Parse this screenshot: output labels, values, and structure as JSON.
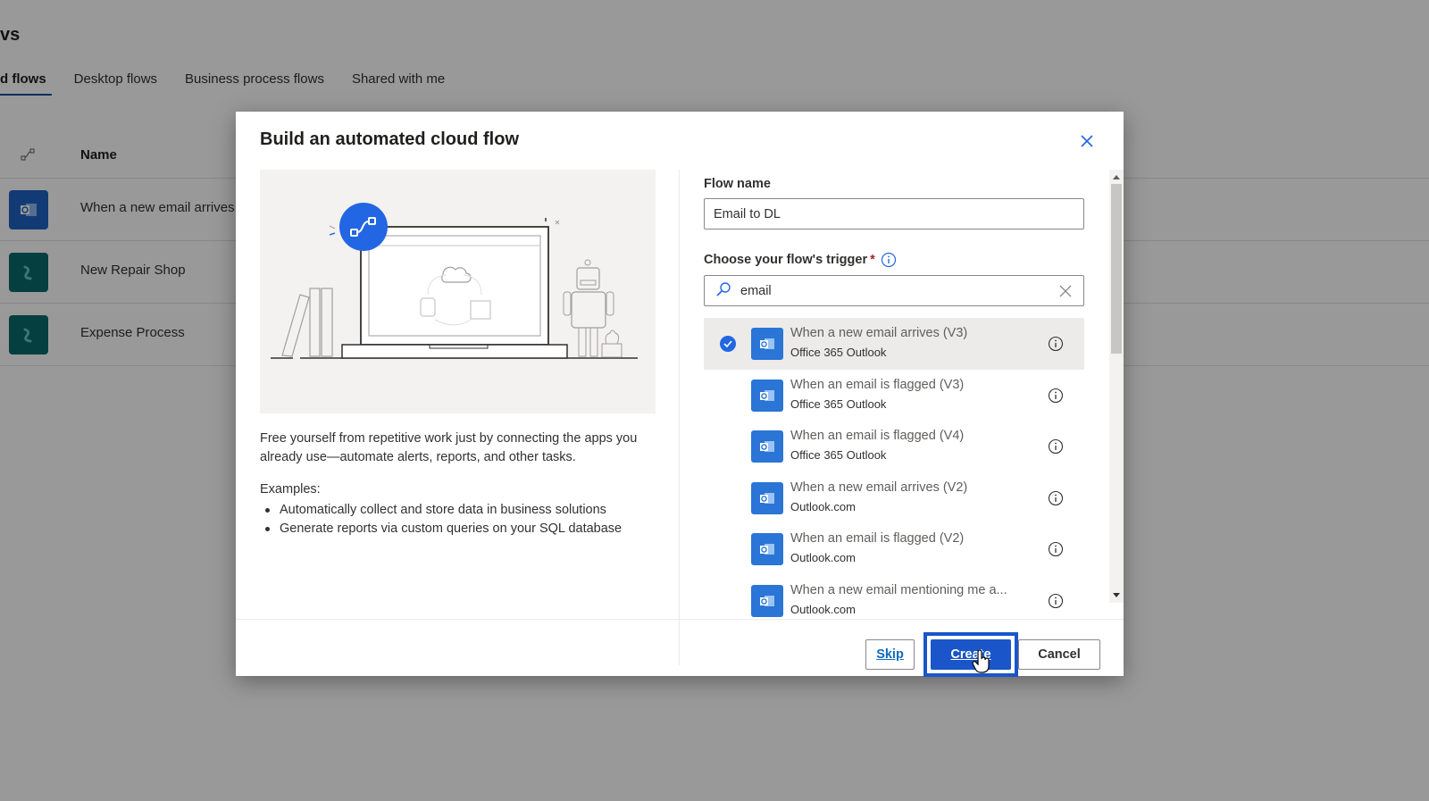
{
  "page": {
    "title": "vs",
    "tabs": [
      {
        "label": "d flows",
        "active": true
      },
      {
        "label": "Desktop flows",
        "active": false
      },
      {
        "label": "Business process flows",
        "active": false
      },
      {
        "label": "Shared with me",
        "active": false
      }
    ],
    "list": {
      "header": {
        "name": "Name",
        "type_icon": "flow-icon"
      },
      "rows": [
        {
          "name": "When a new email arrives",
          "icon": "outlook-icon",
          "color": "#1e63c4"
        },
        {
          "name": "New Repair Shop",
          "icon": "dataverse-icon",
          "color": "#0b6a6a"
        },
        {
          "name": "Expense Process",
          "icon": "dataverse-icon",
          "color": "#0b6a6a"
        }
      ]
    }
  },
  "modal": {
    "title": "Build an automated cloud flow",
    "close_icon": "close-icon",
    "description": "Free yourself from repetitive work just by connecting the apps you already use—automate alerts, reports, and other tasks.",
    "examples_label": "Examples:",
    "examples": [
      "Automatically collect and store data in business solutions",
      "Generate reports via custom queries on your SQL database"
    ],
    "form": {
      "flow_name_label": "Flow name",
      "flow_name_value": "Email to DL",
      "trigger_label": "Choose your flow's trigger",
      "required_mark": "*",
      "search_value": "email",
      "triggers": [
        {
          "title": "When a new email arrives (V3)",
          "connector": "Office 365 Outlook",
          "selected": true
        },
        {
          "title": "When an email is flagged (V3)",
          "connector": "Office 365 Outlook",
          "selected": false
        },
        {
          "title": "When an email is flagged (V4)",
          "connector": "Office 365 Outlook",
          "selected": false
        },
        {
          "title": "When a new email arrives (V2)",
          "connector": "Outlook.com",
          "selected": false
        },
        {
          "title": "When an email is flagged (V2)",
          "connector": "Outlook.com",
          "selected": false
        },
        {
          "title": "When a new email mentioning me a...",
          "connector": "Outlook.com",
          "selected": false
        }
      ]
    },
    "buttons": {
      "skip": "Skip",
      "create": "Create",
      "cancel": "Cancel"
    },
    "colors": {
      "primary": "#1a56c9",
      "connector": "#2a75d6",
      "check": "#2266e3"
    }
  }
}
